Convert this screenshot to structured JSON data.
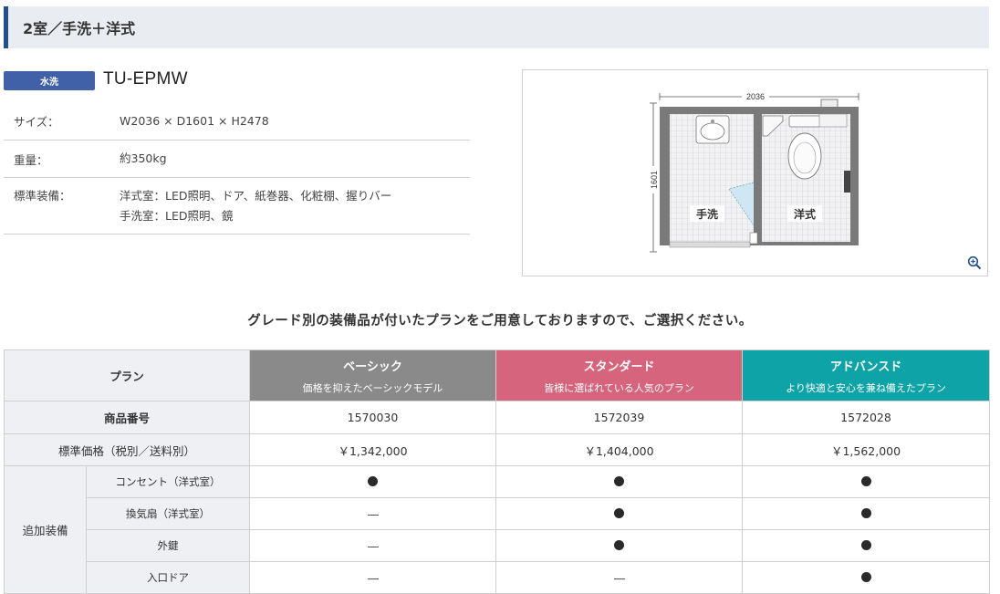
{
  "header": {
    "title": "2室／手洗＋洋式"
  },
  "product": {
    "badge": "水洗",
    "model": "TU-EPMW",
    "specs": [
      {
        "label": "サイズ：",
        "value_lines": [
          "W2036 × D1601 × H2478"
        ]
      },
      {
        "label": "重量：",
        "value_lines": [
          "約350kg"
        ]
      },
      {
        "label": "標準装備：",
        "value_lines": [
          "洋式室：LED照明、ドア、紙巻器、化粧棚、握りバー",
          "手洗室：LED照明、鏡"
        ]
      }
    ]
  },
  "floorplan": {
    "width_label": "2036",
    "depth_label": "1601",
    "room_left": "手洗",
    "room_right": "洋式",
    "zoom_icon": "zoom-in-icon"
  },
  "intro": "グレード別の装備品が付いたプランをご用意しておりますので、ご選択ください。",
  "plans": {
    "header_label": "プラン",
    "grades": [
      {
        "name": "ベーシック",
        "desc": "価格を抑えたベーシックモデル",
        "color": "#8a8a8a"
      },
      {
        "name": "スタンダード",
        "desc": "皆様に選ばれている人気のプラン",
        "color": "#d6647d"
      },
      {
        "name": "アドバンスド",
        "desc": "より快適と安心を兼ね備えたプラン",
        "color": "#0ea3a6"
      }
    ],
    "product_number_label": "商品番号",
    "product_numbers": [
      "1570030",
      "1572039",
      "1572028"
    ],
    "price_label": "標準価格（税別／送料別）",
    "prices": [
      "￥1,342,000",
      "￥1,404,000",
      "￥1,562,000"
    ],
    "options_group_label": "追加装備",
    "options": [
      {
        "label": "コンセント（洋式室）",
        "values": [
          true,
          true,
          true
        ]
      },
      {
        "label": "換気扇（洋式室）",
        "values": [
          false,
          true,
          true
        ]
      },
      {
        "label": "外鍵",
        "values": [
          false,
          true,
          true
        ]
      },
      {
        "label": "入口ドア",
        "values": [
          false,
          false,
          true
        ]
      }
    ]
  }
}
